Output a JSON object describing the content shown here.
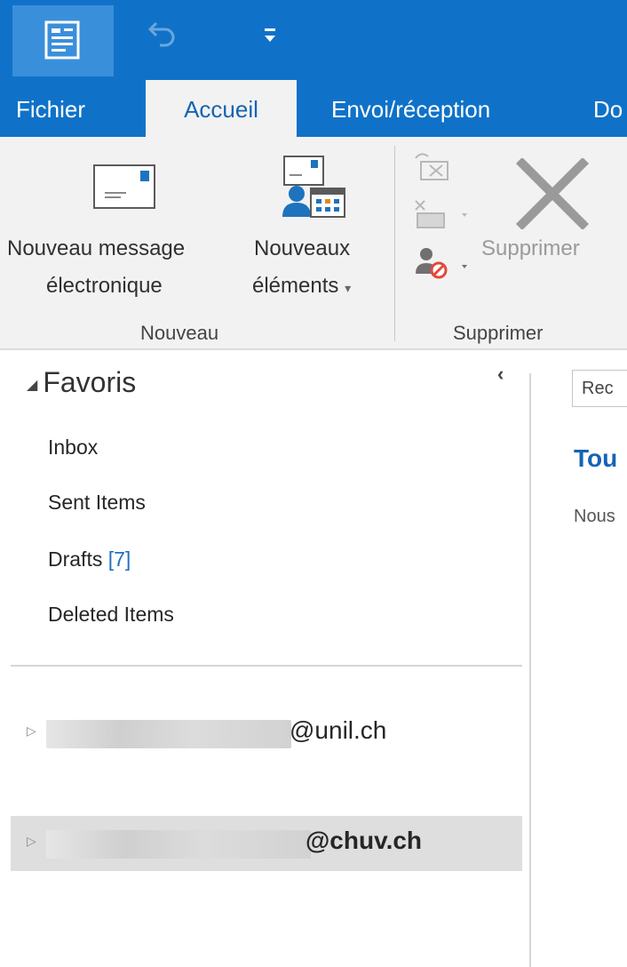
{
  "titlebar": {
    "app_icon": "outlook-app-icon",
    "undo_icon": "undo-icon",
    "quick_access_icon": "customize-quick-access-icon"
  },
  "tabs": [
    {
      "label": "Fichier"
    },
    {
      "label": "Accueil",
      "active": true
    },
    {
      "label": "Envoi/réception"
    },
    {
      "label": "Do"
    }
  ],
  "ribbon": {
    "new_message_line1": "Nouveau message",
    "new_message_line2": "électronique",
    "new_items_line1": "Nouveaux",
    "new_items_line2": "éléments",
    "group_new": "Nouveau",
    "delete_label": "Supprimer",
    "group_delete": "Supprimer",
    "dropdown_arrow": "▾"
  },
  "favorites": {
    "header": "Favoris",
    "collapse_glyph": "‹",
    "folders": [
      {
        "name": "Inbox"
      },
      {
        "name": "Sent Items"
      },
      {
        "name": "Drafts",
        "count": "[7]"
      },
      {
        "name": "Deleted Items"
      }
    ]
  },
  "accounts": [
    {
      "domain": "@unil.ch",
      "selected": false
    },
    {
      "domain": "@chuv.ch",
      "selected": true
    }
  ],
  "reading": {
    "search_placeholder": "Rec",
    "title": "Tou",
    "subtitle": "Nous"
  },
  "colors": {
    "titlebar": "#0f72c8",
    "accent_text": "#1464b4",
    "ribbon": "#f2f2f2"
  }
}
